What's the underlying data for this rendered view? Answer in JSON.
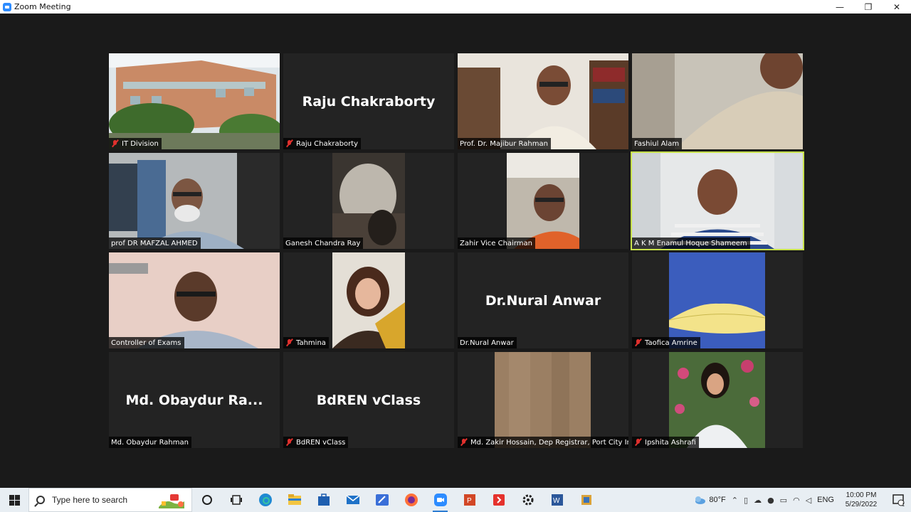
{
  "window": {
    "title": "Zoom Meeting",
    "controls": {
      "minimize": "—",
      "maximize": "❐",
      "close": "✕"
    }
  },
  "meeting": {
    "active_speaker": "A K M Enamul Hoque Shameem",
    "tiles": [
      {
        "name": "IT Division",
        "muted": true,
        "big_name": ""
      },
      {
        "name": "Raju Chakraborty",
        "muted": true,
        "big_name": "Raju Chakraborty"
      },
      {
        "name": "Prof. Dr. Majibur Rahman",
        "muted": false,
        "big_name": ""
      },
      {
        "name": "Fashiul Alam",
        "muted": false,
        "big_name": ""
      },
      {
        "name": "prof DR MAFZAL AHMED",
        "muted": false,
        "big_name": ""
      },
      {
        "name": "Ganesh Chandra Ray",
        "muted": false,
        "big_name": ""
      },
      {
        "name": "Zahir Vice Chairman",
        "muted": false,
        "big_name": ""
      },
      {
        "name": "A K M Enamul Hoque Shameem",
        "muted": false,
        "big_name": ""
      },
      {
        "name": "Controller of Exams",
        "muted": false,
        "big_name": ""
      },
      {
        "name": "Tahmina",
        "muted": true,
        "big_name": ""
      },
      {
        "name": "Dr.Nural Anwar",
        "muted": false,
        "big_name": "Dr.Nural Anwar"
      },
      {
        "name": "Taofica Amrine",
        "muted": true,
        "big_name": ""
      },
      {
        "name": "Md. Obaydur Rahman",
        "muted": false,
        "big_name": "Md. Obaydur Ra..."
      },
      {
        "name": "BdREN vClass",
        "muted": true,
        "big_name": "BdREN vClass"
      },
      {
        "name": "Md. Zakir Hossain, Dep Registrar, Port City Int...",
        "muted": true,
        "big_name": ""
      },
      {
        "name": "Ipshita Ashrafi",
        "muted": true,
        "big_name": ""
      }
    ]
  },
  "taskbar": {
    "search_placeholder": "Type here to search",
    "apps": [
      "cortana-icon",
      "task-view-icon",
      "edge-icon",
      "file-explorer-icon",
      "store-icon",
      "mail-icon",
      "whiteboard-icon",
      "firefox-icon",
      "zoom-icon",
      "powerpoint-icon",
      "anydesk-icon",
      "settings-icon",
      "word-icon",
      "app-icon"
    ],
    "weather": "80°F",
    "language": "ENG",
    "time": "10:00 PM",
    "date": "5/29/2022",
    "notification_count": "1"
  },
  "colors": {
    "active_speaker_border": "#c7e14a",
    "tile_bg": "#232323",
    "meeting_bg": "#1a1a1a",
    "muted_red": "#e0302d"
  }
}
